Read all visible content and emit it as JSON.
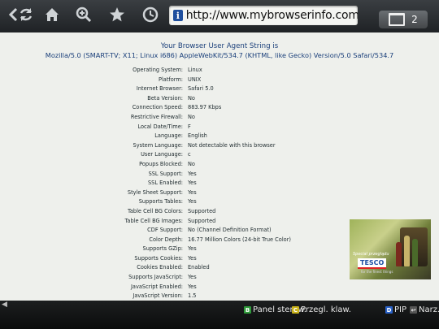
{
  "toolbar": {
    "buttons": [
      "back-icon",
      "refresh-icon",
      "home-icon",
      "zoom-in-icon",
      "bookmark-icon",
      "history-icon"
    ],
    "url": "http://www.mybrowserinfo.com/det...",
    "tab_count": "2"
  },
  "page": {
    "heading": "Your Browser User Agent String is",
    "user_agent": "Mozilla/5.0 (SMART-TV; X11; Linux i686) AppleWebKit/534.7 (KHTML, like Gecko) Version/5.0 Safari/534.7",
    "rows": [
      {
        "k": "Operating System:",
        "v": "Linux"
      },
      {
        "k": "Platform:",
        "v": "UNIX"
      },
      {
        "k": "Internet Browser:",
        "v": "Safari 5.0"
      },
      {
        "k": "Beta Version:",
        "v": "No"
      },
      {
        "k": "Connection Speed:",
        "v": "883.97 Kbps"
      },
      {
        "k": "Restrictive Firewall:",
        "v": "No"
      },
      {
        "k": "Local Date/Time:",
        "v": "F"
      },
      {
        "k": "Language:",
        "v": "English"
      },
      {
        "k": "System Language:",
        "v": "Not detectable with this browser"
      },
      {
        "k": "User Language:",
        "v": "c"
      },
      {
        "k": "Popups Blocked:",
        "v": "No"
      },
      {
        "k": "SSL Support:",
        "v": "Yes"
      },
      {
        "k": "SSL Enabled:",
        "v": "Yes"
      },
      {
        "k": "Style Sheet Support:",
        "v": "Yes"
      },
      {
        "k": "Supports Tables:",
        "v": "Yes"
      },
      {
        "k": "Table Cell BG Colors:",
        "v": "Supported"
      },
      {
        "k": "Table Cell BG Images:",
        "v": "Supported"
      },
      {
        "k": "CDF Support:",
        "v": "No (Channel Definition Format)"
      },
      {
        "k": "Color Depth:",
        "v": "16.77 Million Colors (24-bit True Color)"
      },
      {
        "k": "Supports GZip:",
        "v": "Yes"
      },
      {
        "k": "Supports Cookies:",
        "v": "Yes"
      },
      {
        "k": "Cookies Enabled:",
        "v": "Enabled"
      },
      {
        "k": "Supports JavaScript:",
        "v": "Yes"
      },
      {
        "k": "JavaScript Enabled:",
        "v": "Yes"
      },
      {
        "k": "JavaScript Version:",
        "v": "1.5"
      }
    ],
    "ad": {
      "promo": "Special przeglądu",
      "brand": "TESCO",
      "tagline": "for the finest things"
    }
  },
  "bottom_bar": {
    "hints": [
      {
        "key": "B",
        "color": "#2f9a3a",
        "label": "Panel sterow."
      },
      {
        "key": "C",
        "color": "#c9b21b",
        "label": "Przegl. klaw."
      },
      {
        "key": "D",
        "color": "#2a62c8",
        "label": "PIP"
      },
      {
        "key": "↩",
        "color": "#555555",
        "label": "Narz."
      }
    ]
  }
}
